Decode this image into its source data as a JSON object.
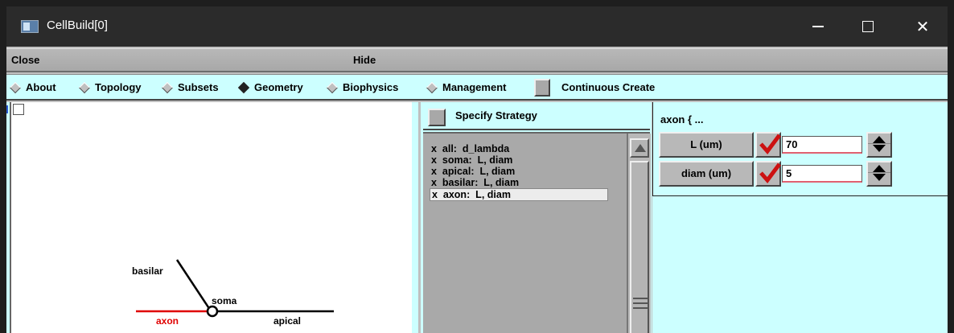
{
  "window": {
    "title": "CellBuild[0]",
    "controls": {
      "minimize": "minimize-icon",
      "maximize": "maximize-icon",
      "close": "close-icon"
    }
  },
  "menubar": {
    "close_label": "Close",
    "hide_label": "Hide"
  },
  "tabs": [
    {
      "label": "About",
      "selected": false
    },
    {
      "label": "Topology",
      "selected": false
    },
    {
      "label": "Subsets",
      "selected": false
    },
    {
      "label": "Geometry",
      "selected": true
    },
    {
      "label": "Biophysics",
      "selected": false
    },
    {
      "label": "Management",
      "selected": false
    }
  ],
  "continuous_create": {
    "label": "Continuous Create",
    "checked": false
  },
  "canvas": {
    "labels": {
      "basilar": "basilar",
      "soma": "soma",
      "axon": "axon",
      "apical": "apical"
    },
    "colors": {
      "axon": "#e00000",
      "default": "#000000",
      "background": "#ffffff"
    }
  },
  "strategy": {
    "button_label": "Specify Strategy",
    "items": [
      {
        "text": "x  all:  d_lambda",
        "selected": false
      },
      {
        "text": "x  soma:  L, diam",
        "selected": false
      },
      {
        "text": "x  apical:  L, diam",
        "selected": false
      },
      {
        "text": "x  basilar:  L, diam",
        "selected": false
      },
      {
        "text": "x  axon:  L, diam",
        "selected": true
      }
    ]
  },
  "section_panel": {
    "title": "axon { ...",
    "params": [
      {
        "label": "L (um)",
        "value": "70",
        "checked": true
      },
      {
        "label": "diam (um)",
        "value": "5",
        "checked": true
      }
    ]
  },
  "theme": {
    "panel_bg": "#ccffff",
    "button_gray": "#b8b8b8",
    "check_red": "#cc1111",
    "title_bar": "#2b2b2b"
  }
}
